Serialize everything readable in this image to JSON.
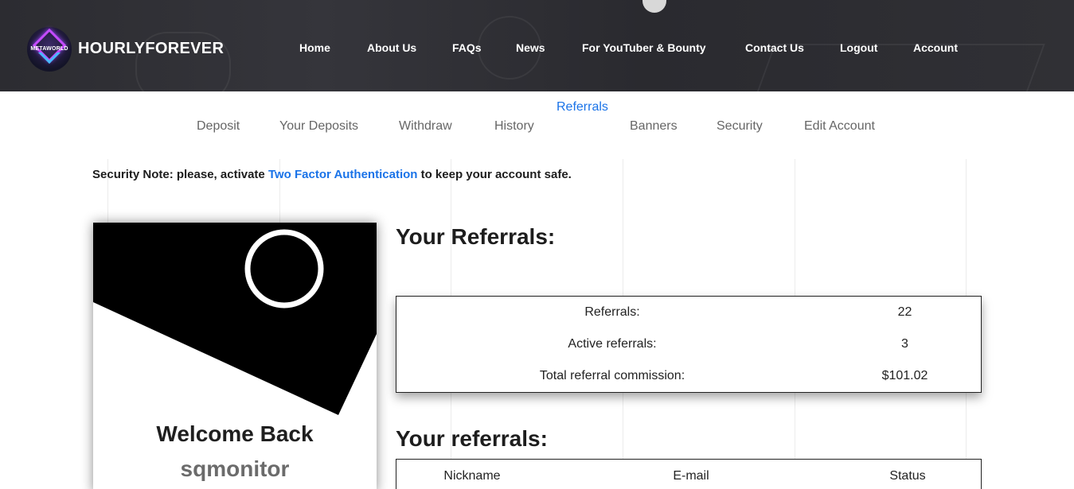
{
  "header": {
    "logo_text": "METAWORLD",
    "brand": "HOURLYFOREVER",
    "nav": [
      {
        "label": "Home"
      },
      {
        "label": "About Us"
      },
      {
        "label": "FAQs"
      },
      {
        "label": "News"
      },
      {
        "label": "For YouTuber & Bounty"
      },
      {
        "label": "Contact Us"
      },
      {
        "label": "Logout"
      },
      {
        "label": "Account"
      }
    ]
  },
  "subnav": {
    "items": [
      {
        "label": "Deposit"
      },
      {
        "label": "Your Deposits"
      },
      {
        "label": "Withdraw"
      },
      {
        "label": "History"
      },
      {
        "label": "Referrals",
        "active": true
      },
      {
        "label": "Banners"
      },
      {
        "label": "Security"
      },
      {
        "label": "Edit Account"
      }
    ]
  },
  "security_note": {
    "prefix": "Security Note: please, activate ",
    "link": "Two Factor Authentication",
    "suffix": " to keep your account safe."
  },
  "profile": {
    "welcome": "Welcome Back",
    "username": "sqmonitor"
  },
  "referrals_summary": {
    "title": "Your Referrals:",
    "rows": [
      {
        "label": "Referrals:",
        "value": "22"
      },
      {
        "label": "Active referrals:",
        "value": "3"
      },
      {
        "label": "Total referral commission:",
        "value": "$101.02"
      }
    ]
  },
  "referrals_list": {
    "title": "Your referrals:",
    "columns": [
      "Nickname",
      "E-mail",
      "Status"
    ]
  },
  "colors": {
    "header_bg": "#2c2c31",
    "accent_link": "#1a73e8",
    "logo_purple": "#c44bff",
    "logo_blue": "#48b9ff"
  }
}
